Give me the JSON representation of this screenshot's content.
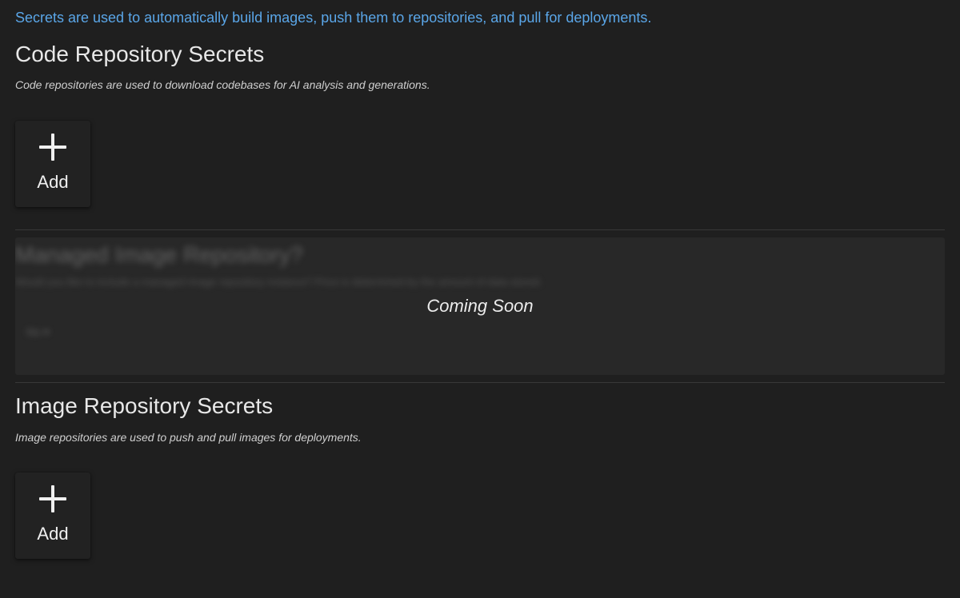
{
  "intro_text": "Secrets are used to automatically build images, push them to repositories, and pull for deployments.",
  "code_section": {
    "title": "Code Repository Secrets",
    "description": "Code repositories are used to download codebases for AI analysis and generations.",
    "add_label": "Add"
  },
  "managed_section": {
    "title": "Managed Image Repository?",
    "description": "Would you like to include a managed image repository instance? Price is determined by the amount of data stored.",
    "select_value": "No",
    "overlay_text": "Coming Soon"
  },
  "image_section": {
    "title": "Image Repository Secrets",
    "description": "Image repositories are used to push and pull images for deployments.",
    "add_label": "Add"
  },
  "colors": {
    "background": "#1f1f1f",
    "link_blue": "#5aa6e8",
    "card": "#222222",
    "panel": "#282828"
  }
}
